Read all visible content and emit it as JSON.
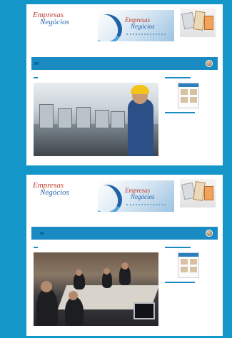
{
  "screens": [
    {
      "logo": {
        "word1": "Empresas",
        "word2": "Negócios",
        "tagline": ""
      },
      "banner": {
        "word1": "Empresas",
        "word2": "Negócios"
      },
      "ad_caption": "",
      "nav": {
        "items": [
          "",
          "",
          "",
          "",
          "",
          "",
          ""
        ],
        "active_index": 0,
        "user_name": ""
      },
      "section_label": "",
      "photo_subject": "factory-workers",
      "sidebar": {
        "title": "",
        "caption": "",
        "link": "",
        "button": ""
      }
    },
    {
      "logo": {
        "word1": "Empresas",
        "word2": "Negócios",
        "tagline": ""
      },
      "banner": {
        "word1": "Empresas",
        "word2": "Negócios"
      },
      "ad_caption": "",
      "nav": {
        "items": [
          "",
          "",
          "",
          "",
          "",
          "",
          ""
        ],
        "active_index": 1,
        "user_name": ""
      },
      "section_label": "",
      "photo_subject": "meeting-room",
      "sidebar": {
        "title": "",
        "caption": "",
        "link": "",
        "button": ""
      }
    }
  ],
  "colors": {
    "background": "#1496c8",
    "nav": "#1a8ac3",
    "nav_active": "#0f6e9e",
    "logo_red": "#c0392b",
    "logo_blue": "#1f62a8"
  }
}
